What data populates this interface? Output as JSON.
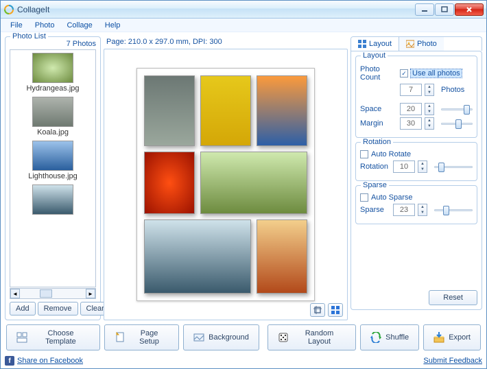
{
  "title": "CollageIt",
  "menu": {
    "file": "File",
    "photo": "Photo",
    "collage": "Collage",
    "help": "Help"
  },
  "photoList": {
    "title": "Photo List",
    "count": "7 Photos",
    "items": [
      {
        "name": "Hydrangeas.jpg"
      },
      {
        "name": "Koala.jpg"
      },
      {
        "name": "Lighthouse.jpg"
      }
    ],
    "add": "Add",
    "remove": "Remove",
    "clear": "Clear"
  },
  "pageInfo": "Page: 210.0 x 297.0 mm, DPI: 300",
  "tabs": {
    "layout": "Layout",
    "photo": "Photo"
  },
  "layout": {
    "group": "Layout",
    "photoCountLabel": "Photo Count",
    "useAll": "Use all photos",
    "useAllChecked": "✓",
    "photoCountValue": "7",
    "photosLabel": "Photos",
    "spaceLabel": "Space",
    "spaceValue": "20",
    "marginLabel": "Margin",
    "marginValue": "30"
  },
  "rotation": {
    "group": "Rotation",
    "auto": "Auto Rotate",
    "label": "Rotation",
    "value": "10"
  },
  "sparse": {
    "group": "Sparse",
    "auto": "Auto Sparse",
    "label": "Sparse",
    "value": "23"
  },
  "reset": "Reset",
  "bottom": {
    "template": "Choose Template",
    "pageSetup": "Page Setup",
    "background": "Background",
    "random": "Random Layout",
    "shuffle": "Shuffle",
    "export": "Export"
  },
  "footer": {
    "share": "Share on Facebook",
    "feedback": "Submit Feedback"
  }
}
